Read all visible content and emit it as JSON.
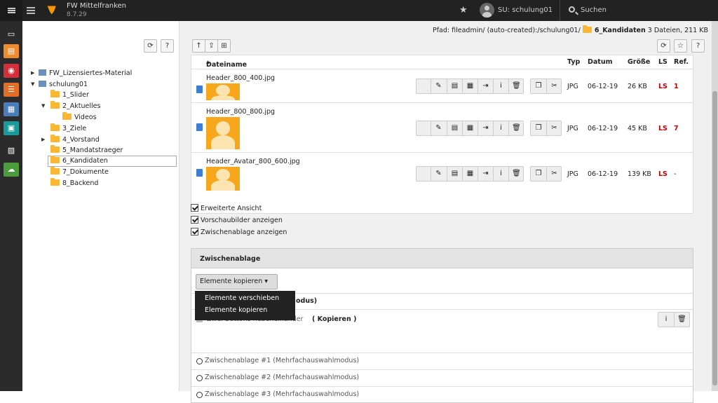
{
  "topbar": {
    "site_name": "FW Mittelfranken",
    "version": "8.7.29",
    "user": "SU: schulung01",
    "search": "Suchen"
  },
  "modules": [
    {
      "icon": "page-icon",
      "color": "#333"
    },
    {
      "icon": "document-icon",
      "color": "#f08c30"
    },
    {
      "icon": "eye-icon",
      "color": "#d2313b"
    },
    {
      "icon": "list-icon",
      "color": "#e07028"
    },
    {
      "icon": "news-icon",
      "color": "#4a7cb8"
    },
    {
      "icon": "chat-icon",
      "color": "#199b9b"
    },
    {
      "icon": "image-icon",
      "color": "#333"
    },
    {
      "icon": "cloud-icon",
      "color": "#4c9b3c"
    }
  ],
  "tree": {
    "items": [
      {
        "label": "FW_Lizensiertes-Material"
      },
      {
        "label": "schulung01"
      },
      {
        "label": "1_Slider"
      },
      {
        "label": "2_Aktuelles"
      },
      {
        "label": "Videos"
      },
      {
        "label": "3_Ziele"
      },
      {
        "label": "4_Vorstand"
      },
      {
        "label": "5_Mandatstraeger"
      },
      {
        "label": "6_Kandidaten"
      },
      {
        "label": "7_Dokumente"
      },
      {
        "label": "8_Backend"
      }
    ],
    "selected": "6_Kandidaten"
  },
  "path": {
    "label": "Pfad: fileadmin/ (auto-created):/schulung01/",
    "current": "6_Kandidaten",
    "summary": "3 Dateien, 211 KB"
  },
  "table": {
    "headers": {
      "name": "Dateiname",
      "type": "Typ",
      "date": "Datum",
      "size": "Größe",
      "ls": "LS",
      "ref": "Ref."
    },
    "rows": [
      {
        "name": "Header_800_400.jpg",
        "type": "JPG",
        "date": "06-12-19",
        "size": "26 KB",
        "ls": "LS",
        "ref": "1"
      },
      {
        "name": "Header_800_800.jpg",
        "type": "JPG",
        "date": "06-12-19",
        "size": "45 KB",
        "ls": "LS",
        "ref": "7"
      },
      {
        "name": "Header_Avatar_800_600.jpg",
        "type": "JPG",
        "date": "06-12-19",
        "size": "139 KB",
        "ls": "LS",
        "ref": "-"
      }
    ]
  },
  "options": {
    "extended": "Erweiterte Ansicht",
    "thumbs": "Vorschaubilder anzeigen",
    "clipboard": "Zwischenablage anzeigen"
  },
  "clipboard": {
    "title": "Zwischenablage",
    "dropdown": "Elemente kopieren",
    "menu": [
      "Elemente verschieben",
      "Elemente kopieren"
    ],
    "row_mode_tail": "odus)",
    "row2_text": "Zwei Buttons nebeneinander",
    "row2_mode": "( Kopieren )",
    "pads": [
      "Zwischenablage #1 (Mehrfachauswahlmodus)",
      "Zwischenablage #2 (Mehrfachauswahlmodus)",
      "Zwischenablage #3 (Mehrfachauswahlmodus)"
    ]
  }
}
